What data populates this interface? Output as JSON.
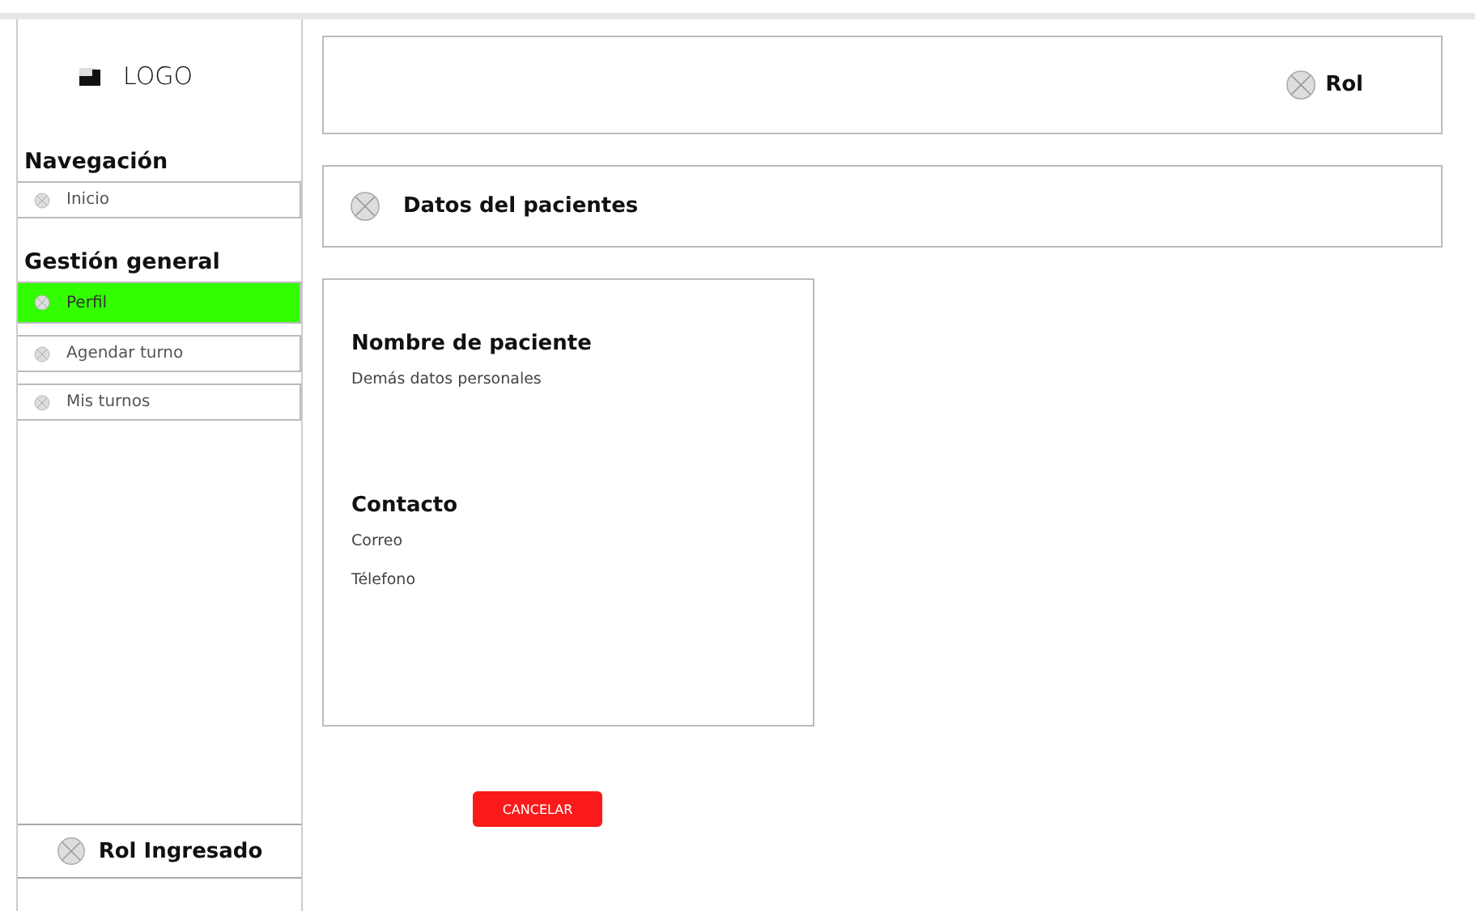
{
  "sidebar": {
    "logo": "LOGO",
    "sections": [
      {
        "title": "Navegación",
        "items": [
          {
            "label": "Inicio",
            "selected": false
          }
        ]
      },
      {
        "title": "Gestión general",
        "items": [
          {
            "label": "Perfil",
            "selected": true
          },
          {
            "label": "Agendar turno",
            "selected": false
          },
          {
            "label": "Mis turnos",
            "selected": false
          }
        ]
      }
    ],
    "role": "Rol Ingresado"
  },
  "header": {
    "role": "Rol"
  },
  "page_title": "Datos del pacientes",
  "profile": {
    "sections": [
      {
        "title": "Nombre de paciente",
        "lines": [
          "Demás datos personales"
        ]
      },
      {
        "title": "Contacto",
        "lines": [
          "Correo",
          "Télefono"
        ]
      }
    ]
  },
  "cancel_button": "CANCELAR"
}
